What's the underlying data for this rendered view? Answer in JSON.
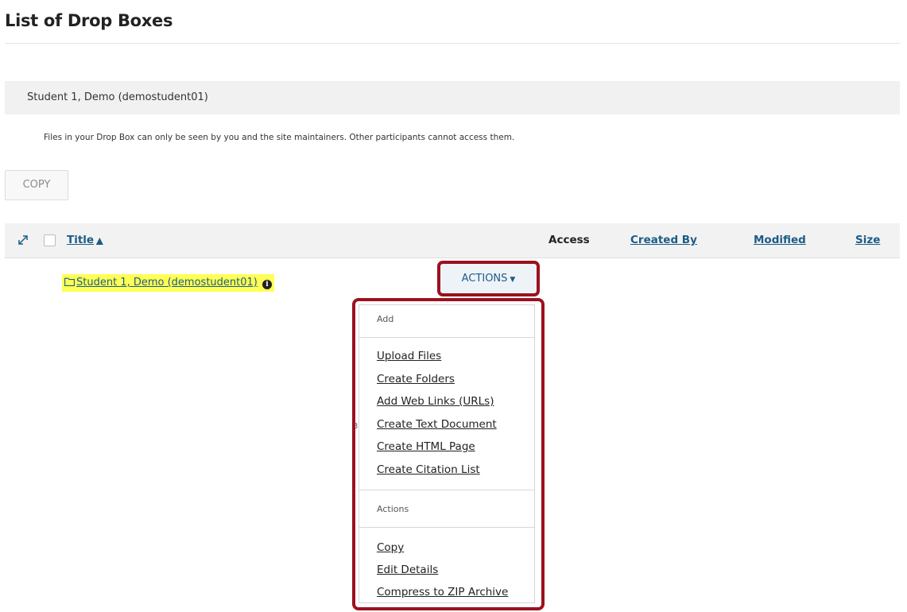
{
  "page": {
    "title": "List of Drop Boxes",
    "user_bar": "Student 1, Demo (demostudent01)",
    "notice": "Files in your Drop Box can only be seen by you and the site maintainers. Other participants cannot access them.",
    "copy_button": "COPY"
  },
  "table": {
    "columns": {
      "title": "Title",
      "access": "Access",
      "created_by": "Created By",
      "modified": "Modified",
      "size": "Size"
    },
    "rows": [
      {
        "name": "Student 1, Demo (demostudent01)"
      }
    ]
  },
  "actions": {
    "button_label": "ACTIONS",
    "menu": {
      "add_header": "Add",
      "add_items": [
        "Upload Files",
        "Create Folders",
        "Add Web Links (URLs)",
        "Create Text Document",
        "Create HTML Page",
        "Create Citation List"
      ],
      "actions_header": "Actions",
      "action_items": [
        "Copy",
        "Edit Details",
        "Compress to ZIP Archive"
      ]
    }
  },
  "icons": {
    "expand": "expand-arrows-icon",
    "sort": "chevron-up-icon",
    "folder": "folder-icon",
    "info": "info-circle-icon",
    "caret": "caret-down-icon"
  },
  "colors": {
    "link": "#1c5c86",
    "highlight_border": "#9b111e",
    "row_highlight": "#ffff55"
  }
}
